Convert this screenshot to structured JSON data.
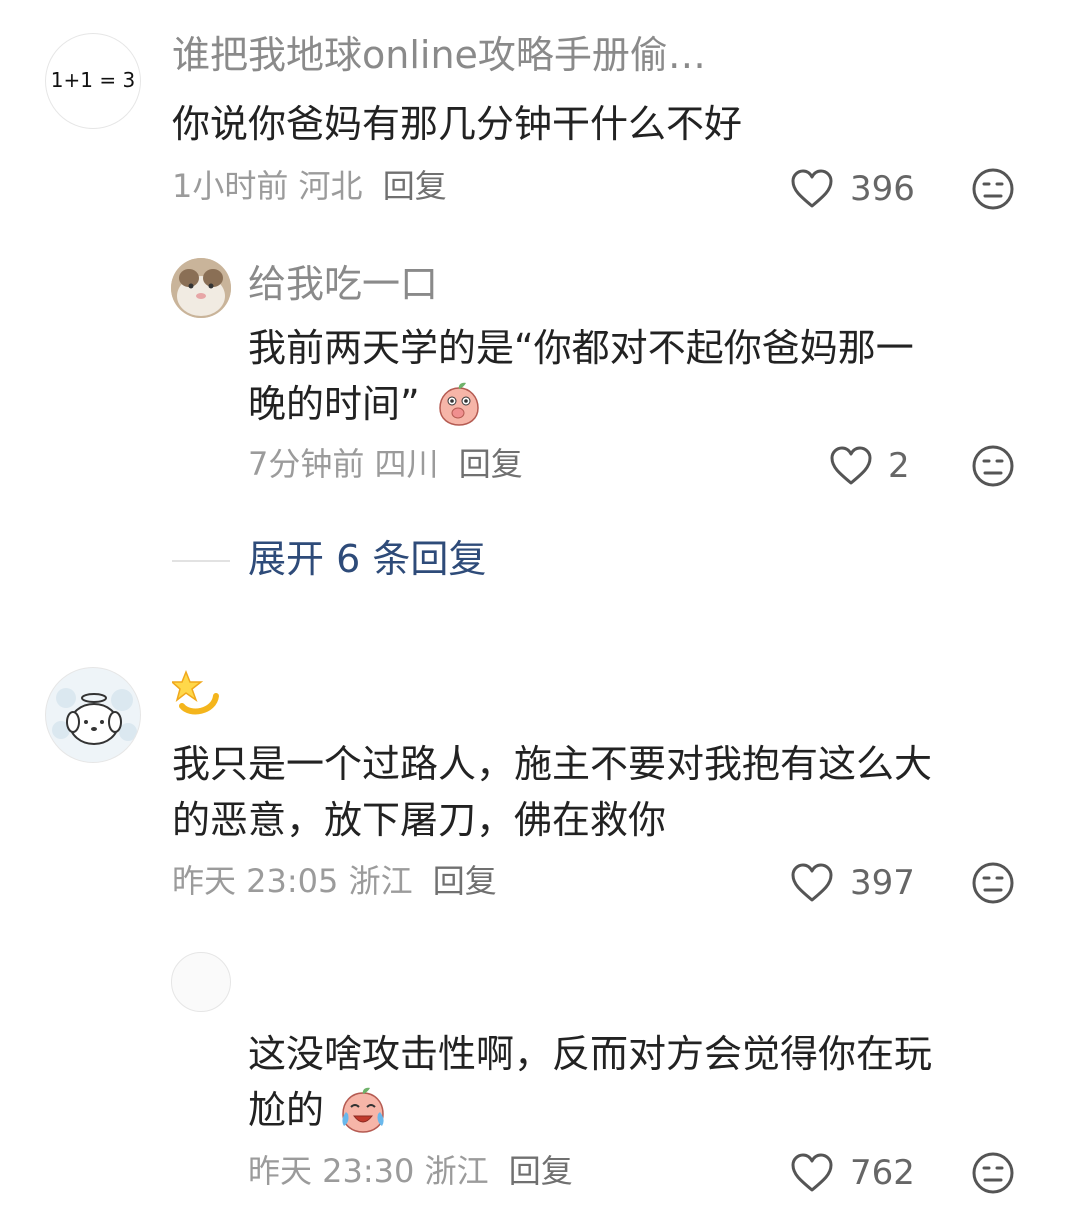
{
  "comments": [
    {
      "avatar_text": "1+1 = 3",
      "username": "谁把我地球online攻略手册偷…",
      "text": "你说你爸妈有那几分钟干什么不好",
      "time": "1小时前",
      "location": "河北",
      "reply_label": "回复",
      "likes": "396"
    },
    {
      "username": "给我吃一口",
      "text_line1": "我前两天学的是“你都对不起你爸妈那一",
      "text_line2": "晚的时间”",
      "emoji_icon": "peach-shy-icon",
      "time": "7分钟前",
      "location": "四川",
      "reply_label": "回复",
      "likes": "2"
    },
    {
      "expand_label": "展开 6 条回复"
    },
    {
      "username_emoji": "dizzy-star-icon",
      "text_line1": "我只是一个过路人，施主不要对我抱有这么大",
      "text_line2": "的恶意，放下屠刀，佛在救你",
      "time": "昨天 23:05",
      "location": "浙江",
      "reply_label": "回复",
      "likes": "397"
    },
    {
      "text_line1": "这没啥攻击性啊，反而对方会觉得你在玩",
      "text_line2": "尬的",
      "emoji_icon": "peach-laugh-cry-icon",
      "time": "昨天 23:30",
      "location": "浙江",
      "reply_label": "回复",
      "likes": "762"
    }
  ],
  "colors": {
    "link": "#2e4b79",
    "meta": "#9b9b9b",
    "username": "#8a8a8a"
  }
}
